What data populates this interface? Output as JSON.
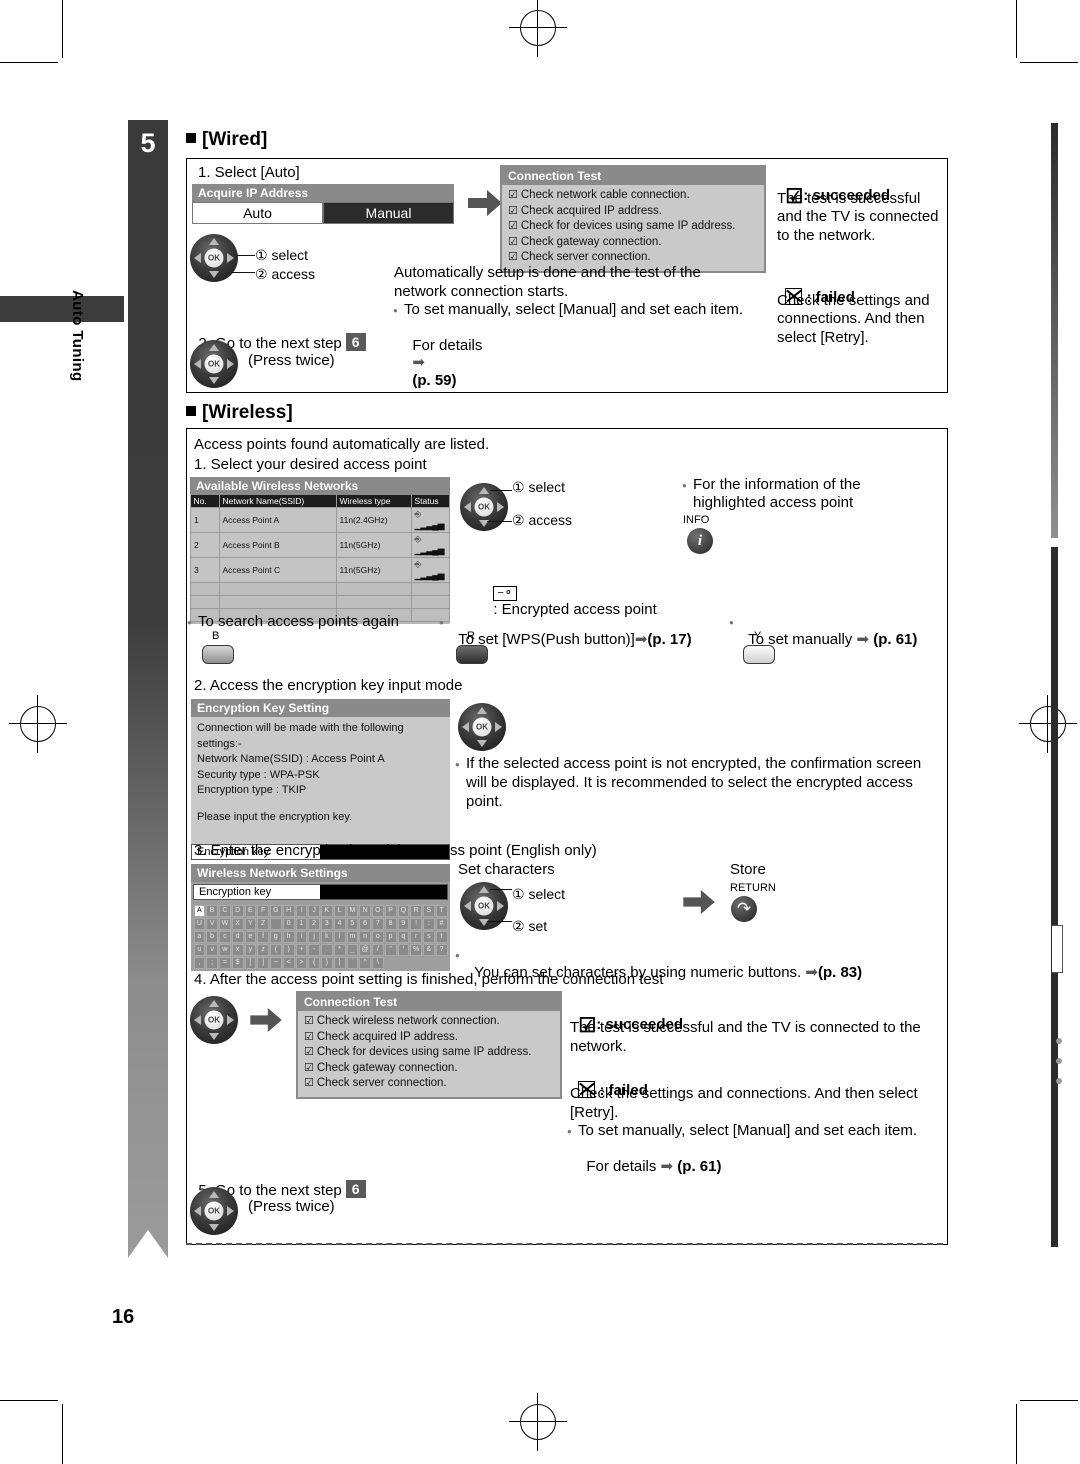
{
  "page": {
    "number": "16",
    "chapter_tab_number": "5",
    "side_label": "Auto Tuning"
  },
  "wired": {
    "heading": "[Wired]",
    "step1": "1. Select [Auto]",
    "ip_menu": {
      "title": "Acquire IP Address",
      "option_auto": "Auto",
      "option_manual": "Manual"
    },
    "pad_label_1": "① select",
    "pad_label_2": "② access",
    "step2": "2. Go to the next step",
    "step2_num": "6",
    "press_twice": "(Press twice)",
    "connection_test": {
      "title": "Connection Test",
      "items": [
        "Check network cable connection.",
        "Check acquired IP address.",
        "Check for devices using same IP address.",
        "Check gateway connection.",
        "Check server connection."
      ]
    },
    "desc_line1": "Automatically setup is done and the test of the",
    "desc_line2": "network connection starts.",
    "note_line1": "To set manually, select [Manual] and set each item.",
    "note_line2": "For details",
    "note_page": "(p. 59)",
    "succeeded_label": ": succeeded",
    "succeeded_text": "The test is successful and the TV is connected to the network.",
    "failed_label": ": failed",
    "failed_text": "Check the settings and connections. And then select [Retry]."
  },
  "wireless": {
    "heading": "[Wireless]",
    "intro": "Access points found automatically are listed.",
    "step1": "1. Select your desired access point",
    "networks": {
      "title": "Available Wireless Networks",
      "columns": [
        "No.",
        "Network Name(SSID)",
        "Wireless type",
        "Status"
      ],
      "rows": [
        {
          "no": "1",
          "ssid": "Access Point A",
          "type": "11n(2.4GHz)",
          "lock": true,
          "signal": 5
        },
        {
          "no": "2",
          "ssid": "Access Point B",
          "type": "11n(5GHz)",
          "lock": true,
          "signal": 5
        },
        {
          "no": "3",
          "ssid": "Access Point C",
          "type": "11n(5GHz)",
          "lock": true,
          "signal": 5
        }
      ],
      "empty_rows": 3
    },
    "pad_label_1": "① select",
    "pad_label_2": "② access",
    "info_note_l1": "For the information of the",
    "info_note_l2": "highlighted access point",
    "info_label": "INFO",
    "encrypted_legend": ": Encrypted access point",
    "opt_search": "To search access points again",
    "opt_search_btn": "B",
    "opt_wps": "To set [WPS(Push button)]",
    "opt_wps_page": "(p. 17)",
    "opt_wps_btn": "R",
    "opt_manual": "To set manually",
    "opt_manual_page": "(p. 61)",
    "opt_manual_btn": "Y",
    "step2": "2. Access the encryption key input mode",
    "enc_key_setting": {
      "title": "Encryption Key Setting",
      "line1": "Connection will be made with the following settings:-",
      "line2": "Network Name(SSID) : Access Point A",
      "line3": "Security type : WPA-PSK",
      "line4": "Encryption type : TKIP",
      "line5": "Please input the encryption key.",
      "field_label": "Encryption key"
    },
    "enc_note": "If the selected access point is not encrypted, the confirmation screen will be displayed. It is recommended to select the encrypted access point.",
    "step3": "3. Enter the encryption key of the access point (English only)",
    "keyboard": {
      "title": "Wireless Network Settings",
      "field_label": "Encryption key",
      "rows": [
        [
          "A",
          "B",
          "C",
          "D",
          "E",
          "F",
          "G",
          "H",
          "I",
          "J",
          "K",
          "L",
          "M",
          "N",
          "O",
          "P",
          "Q",
          "R",
          "S",
          "T"
        ],
        [
          "U",
          "V",
          "W",
          "X",
          "Y",
          "Z",
          " ",
          "0",
          "1",
          "2",
          "3",
          "4",
          "5",
          "6",
          "7",
          "8",
          "9",
          "!",
          ":",
          "#"
        ],
        [
          "a",
          "b",
          "c",
          "d",
          "e",
          "f",
          "g",
          "h",
          "i",
          "j",
          "k",
          "l",
          "m",
          "n",
          "o",
          "p",
          "q",
          "r",
          "s",
          "t"
        ],
        [
          "u",
          "v",
          "w",
          "x",
          "y",
          "z",
          "(",
          ")",
          "+",
          "-",
          ".",
          "*",
          "_",
          "@",
          "/",
          "\"",
          "'",
          "%",
          "&",
          "?"
        ],
        [
          ",",
          ";",
          "=",
          "$",
          "[",
          "]",
          "~",
          "<",
          ">",
          "{",
          "}",
          "|",
          "`",
          "^",
          "\\"
        ]
      ],
      "selected": "A"
    },
    "set_characters": "Set characters",
    "kb_pad_label_1": "① select",
    "kb_pad_label_2": "② set",
    "store": "Store",
    "return_label": "RETURN",
    "numeric_note": "You can set characters by using numeric buttons.",
    "numeric_note_page": "(p. 83)",
    "step4": "4. After the access point setting is finished, perform the connection test",
    "connection_test": {
      "title": "Connection Test",
      "items": [
        "Check wireless network connection.",
        "Check acquired IP address.",
        "Check for devices using same IP address.",
        "Check gateway connection.",
        "Check server connection."
      ]
    },
    "succeeded_label": ": succeeded",
    "succeeded_text": "The test is successful and the TV is connected to the network.",
    "failed_label": ": failed",
    "failed_text": "Check the settings and connections. And then select [Retry].",
    "failed_note_l1": "To set manually, select [Manual] and set each item.",
    "failed_note_l2": "For details",
    "failed_note_page": "(p. 61)",
    "step5": "5. Go to the next step",
    "step5_num": "6",
    "press_twice": "(Press twice)"
  },
  "colors": {
    "tab_dark": "#3a3a3a",
    "tab_light": "#9a9a9a",
    "osd_title": "#8a8a8a",
    "osd_body": "#c9c9c9"
  }
}
